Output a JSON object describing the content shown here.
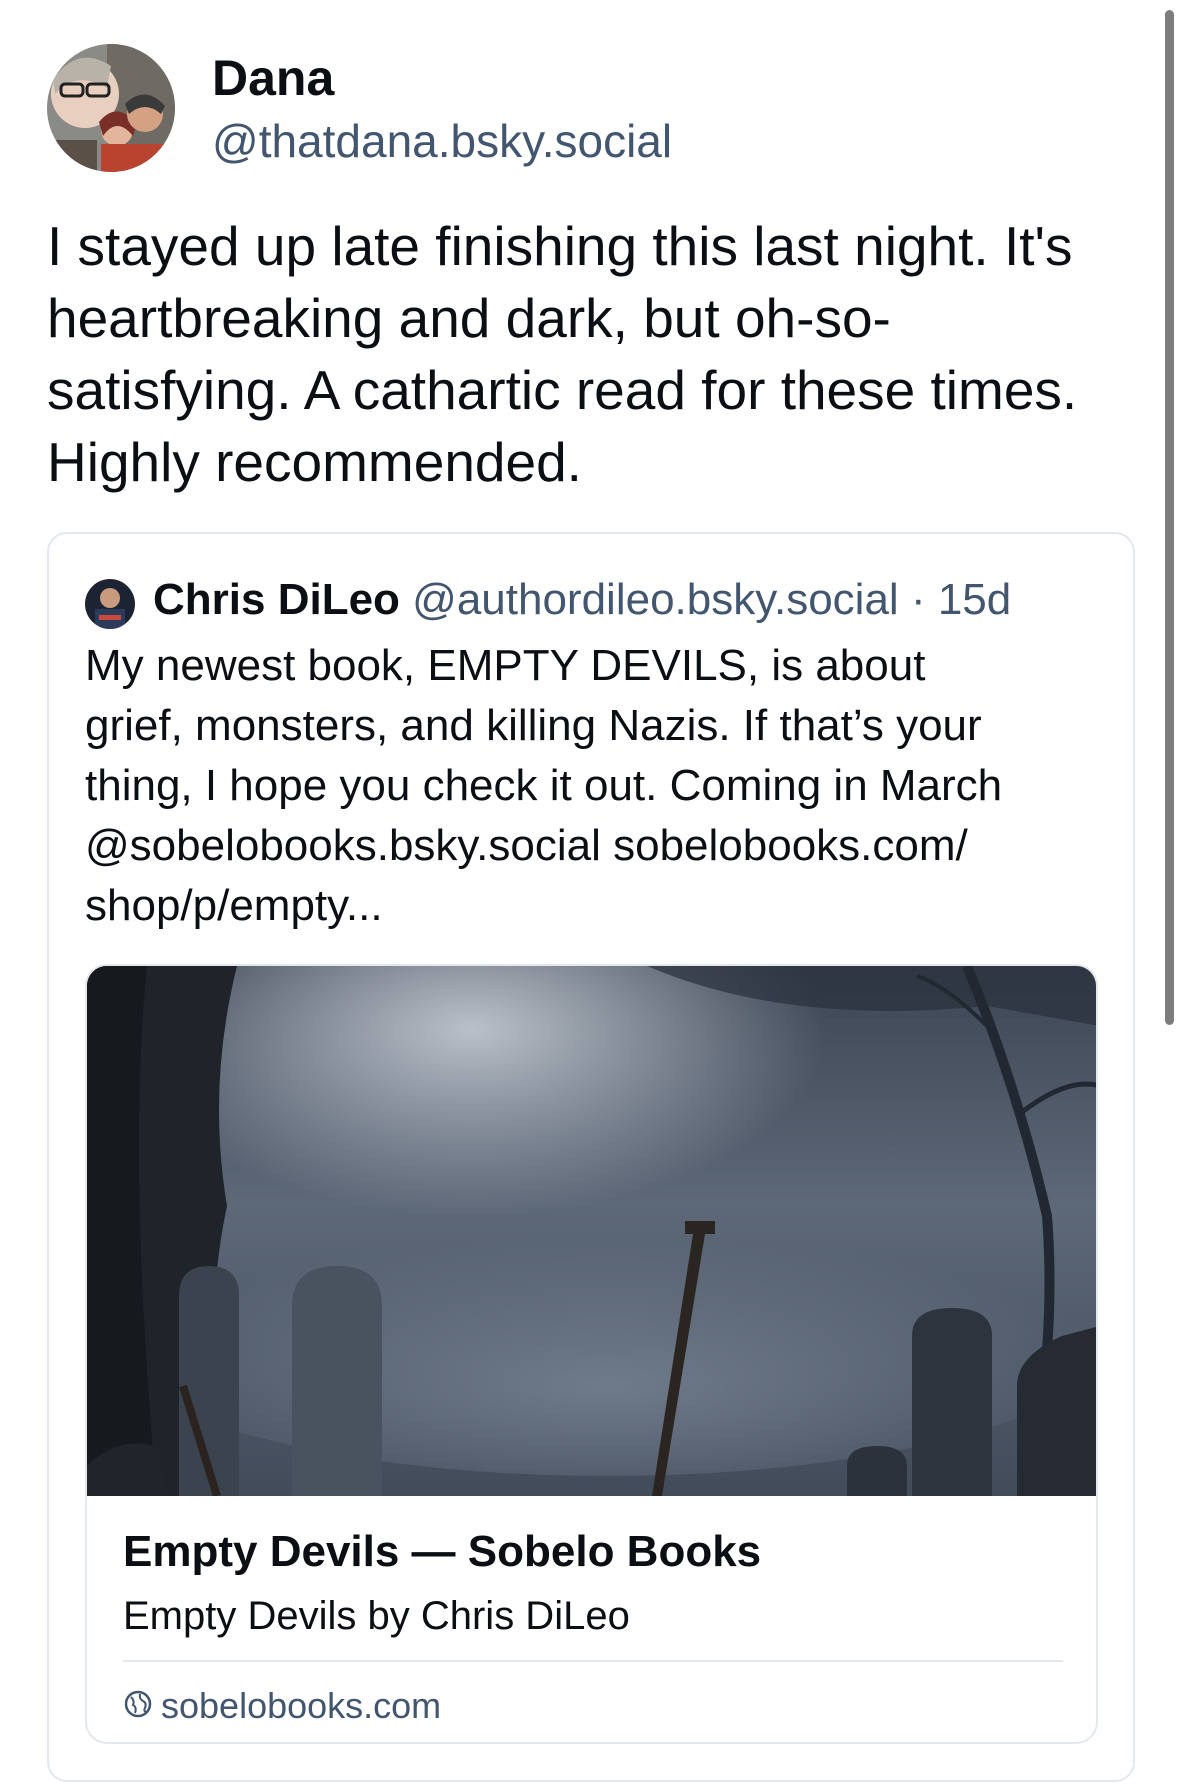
{
  "post": {
    "author_name": "Dana",
    "author_handle": "@thatdana.bsky.social",
    "text": "I stayed up late finishing this last night. It's heartbreaking and dark, but oh-so-satisfying. A cathartic read for these times. Highly recommended."
  },
  "quoted_post": {
    "author_name": "Chris DiLeo",
    "author_handle": "@authordileo.bsky.social",
    "separator": "·",
    "time": "15d",
    "text_lines": [
      "My newest book, EMPTY DEVILS, is about",
      "grief, monsters, and killing Nazis. If that’s your",
      "thing, I hope you check it out. Coming in March",
      "@sobelobooks.bsky.social sobelobooks.com/",
      "shop/p/empty..."
    ],
    "link_card": {
      "title": "Empty Devils — Sobelo Books",
      "description": "Empty Devils by Chris DiLeo",
      "domain": "sobelobooks.com",
      "domain_icon": "globe-icon"
    }
  },
  "colors": {
    "primary_text": "#0b0f14",
    "secondary_text": "#42566f",
    "border": "#e3e8ee",
    "background": "#ffffff"
  }
}
